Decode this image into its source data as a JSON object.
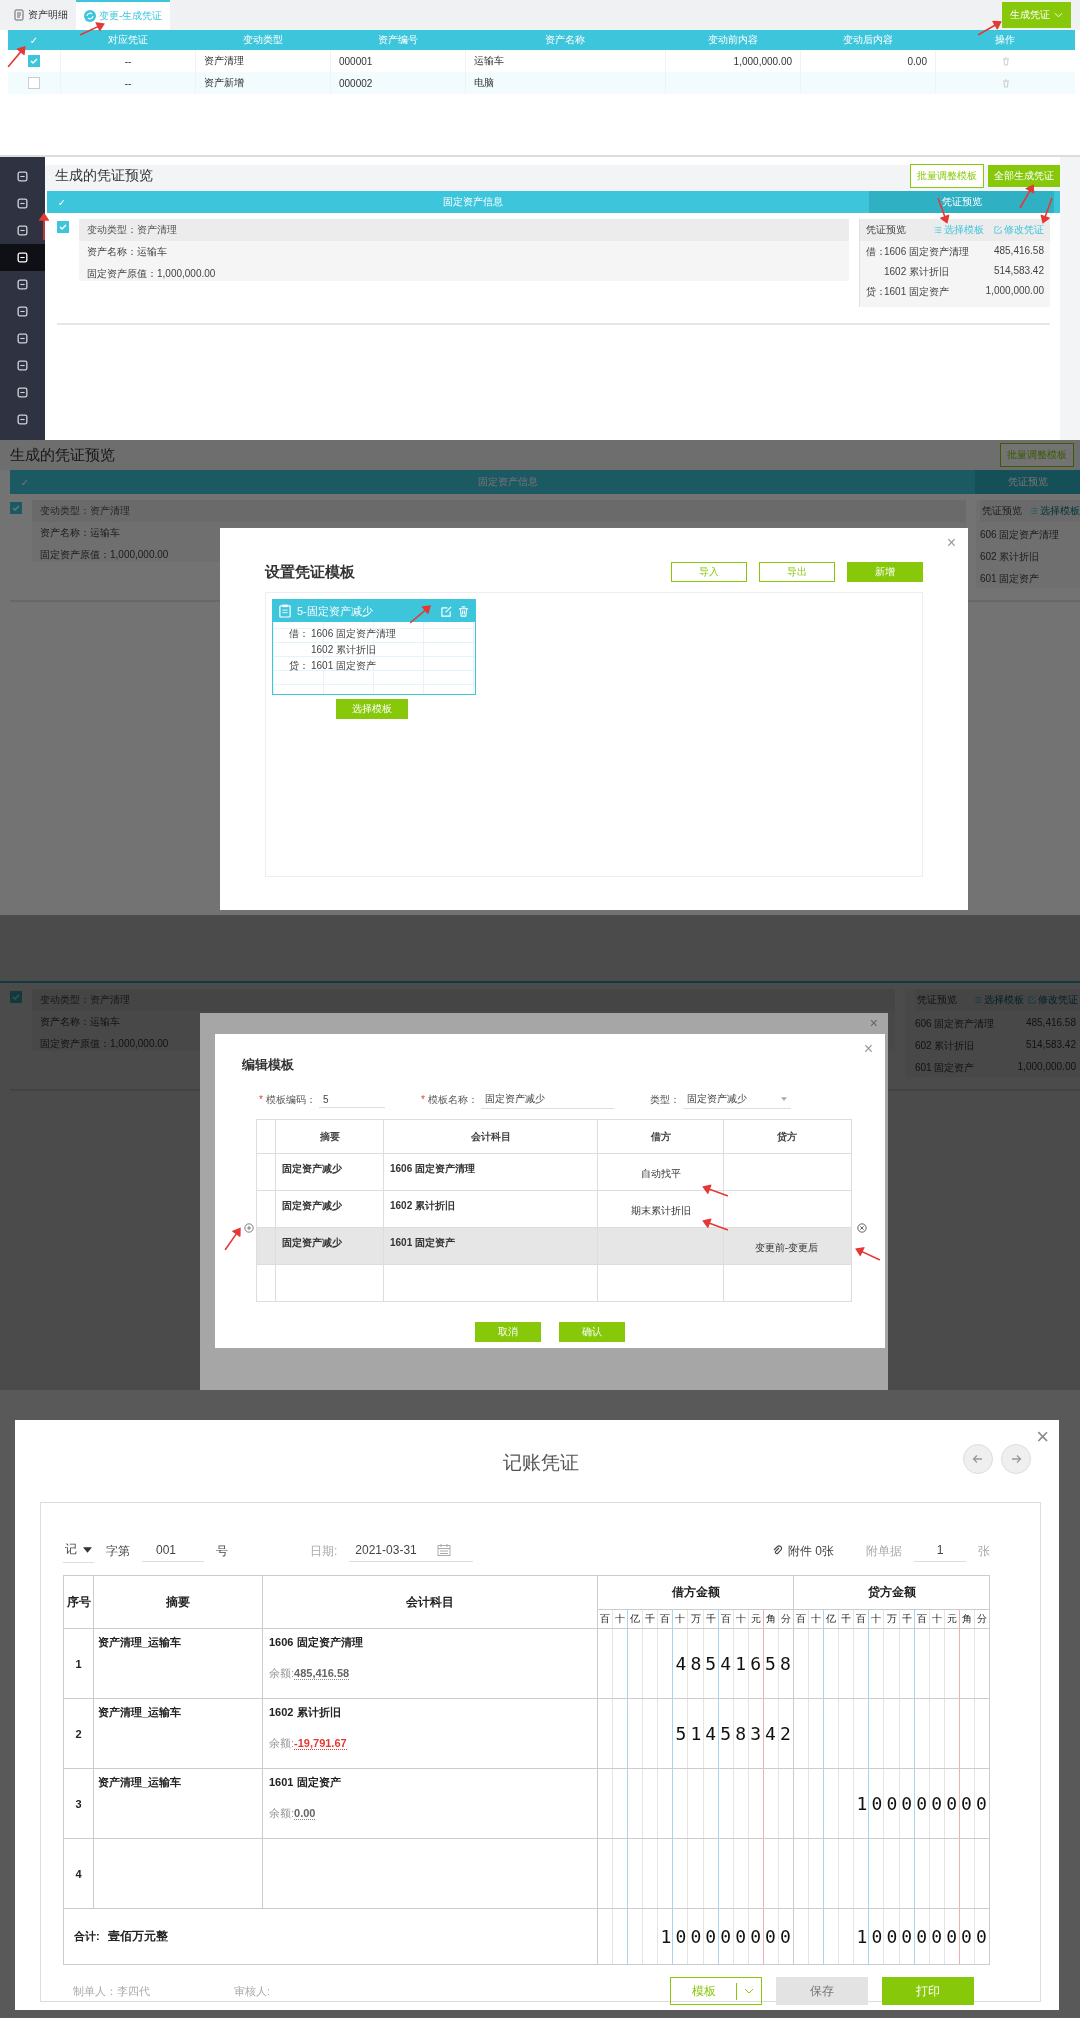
{
  "asset_page": {
    "tabs": [
      {
        "label": "资产明细",
        "selected": false
      },
      {
        "label": "变更-生成凭证",
        "selected": true
      }
    ],
    "generate_button": "生成凭证",
    "columns": [
      "✓",
      "对应凭证",
      "变动类型",
      "资产编号",
      "资产名称",
      "变动前内容",
      "变动后内容",
      "操作"
    ],
    "rows": [
      {
        "checked": true,
        "voucher": "--",
        "type": "资产清理",
        "code": "000001",
        "name": "运输车",
        "before": "1,000,000.00",
        "after": "0.00"
      },
      {
        "checked": false,
        "voucher": "--",
        "type": "资产新增",
        "code": "000002",
        "name": "电脑"
      }
    ]
  },
  "preview_page": {
    "sidebar": [
      {
        "selected": false
      },
      {
        "selected": false
      },
      {
        "selected": false
      },
      {
        "selected": true
      },
      {
        "selected": false
      },
      {
        "selected": false
      },
      {
        "selected": false
      },
      {
        "selected": false
      },
      {
        "selected": false
      },
      {
        "selected": false
      }
    ],
    "title": "生成的凭证预览",
    "buttons": [
      {
        "label": "批量调整模板",
        "kind": "outline"
      },
      {
        "label": "全部生成凭证",
        "kind": "primary"
      }
    ],
    "header": {
      "check": "✓",
      "info": "固定资产信息",
      "preview": "凭证预览"
    },
    "card": {
      "checked": true,
      "type_line": "变动类型：资产清理",
      "lines": [
        "资产名称：运输车",
        "固定资产原值：1,000,000.00"
      ]
    },
    "voucher": {
      "title": "凭证预览",
      "links": [
        {
          "label": "选择模板",
          "kind": "list"
        },
        {
          "label": "修改凭证",
          "kind": "edit"
        }
      ],
      "entries": [
        {
          "side": "借：",
          "account": "1606 固定资产清理",
          "amount": "485,416.58"
        },
        {
          "account": "1602 累计折旧",
          "amount": "514,583.42"
        },
        {
          "side": "贷：",
          "account": "1601 固定资产",
          "amount": "1,000,000.00"
        }
      ]
    }
  },
  "template_dialog": {
    "backdrop": {
      "title": "生成的凭证预览",
      "button": "批量调整模板",
      "header": {
        "check": "✓",
        "info": "固定资产信息",
        "preview": "凭证预览"
      },
      "card": {
        "checked": true,
        "type_line": "变动类型：资产清理",
        "lines": [
          "资产名称：运输车",
          "固定资产原值：1,000,000.00"
        ]
      },
      "voucher": {
        "title": "凭证预览",
        "links": [
          {
            "label": "选择模板",
            "kind": "list"
          }
        ],
        "entries": [
          {
            "account": "606 固定资产清理"
          },
          {
            "account": "602 累计折旧"
          },
          {
            "account": "601 固定资产"
          }
        ]
      }
    },
    "close": "×",
    "title": "设置凭证模板",
    "buttons": [
      {
        "label": "导入",
        "kind": "outline"
      },
      {
        "label": "导出",
        "kind": "outline"
      },
      {
        "label": "新增",
        "kind": "primary"
      }
    ],
    "template": {
      "name": "5-固定资产减少",
      "lines": [
        {
          "side": "借：",
          "account": "1606 固定资产清理"
        },
        {
          "account": "1602 累计折旧"
        },
        {
          "side": "贷：",
          "account": "1601 固定资产"
        }
      ],
      "button": "选择模板"
    }
  },
  "edit_dialog": {
    "backdrop": {
      "card": {
        "checked": true,
        "type_line": "变动类型：资产清理",
        "lines": [
          "资产名称：运输车",
          "固定资产原值：1,000,000.00"
        ]
      },
      "voucher": {
        "title": "凭证预览",
        "links": [
          {
            "label": "选择模板",
            "kind": "list"
          },
          {
            "label": "修改凭证",
            "kind": "edit"
          }
        ],
        "entries": [
          {
            "account": "606 固定资产清理",
            "amount": "485,416.58"
          },
          {
            "account": "602 累计折旧",
            "amount": "514,583.42"
          },
          {
            "account": "601 固定资产",
            "amount": "1,000,000.00"
          }
        ]
      }
    },
    "back_close": "×",
    "close": "×",
    "title": "编辑模板",
    "fields": [
      {
        "mark": "*",
        "label": "模板编码：",
        "value": "5",
        "kind": "text"
      },
      {
        "mark": "*",
        "label": "模板名称：",
        "value": "固定资产减少",
        "kind": "text"
      },
      {
        "label": "类型：",
        "value": "固定资产减少",
        "kind": "select"
      }
    ],
    "columns": [
      "摘要",
      "会计科目",
      "借方",
      "贷方"
    ],
    "rows": [
      {
        "summary": "固定资产减少",
        "account": "1606 固定资产清理",
        "debit": "自动找平",
        "highlighted": false
      },
      {
        "summary": "固定资产减少",
        "account": "1602 累计折旧",
        "debit": "期末累计折旧",
        "highlighted": false
      },
      {
        "summary": "固定资产减少",
        "account": "1601 固定资产",
        "credit": "变更前-变更后",
        "highlighted": true
      },
      {
        "highlighted": false
      }
    ],
    "buttons": [
      {
        "label": "取消"
      },
      {
        "label": "确认"
      }
    ]
  },
  "voucher_dialog": {
    "close": "×",
    "title": "记账凭证",
    "type": "记",
    "word": "字第",
    "number": "001",
    "number_suffix": "号",
    "date_label": "日期:",
    "date": "2021-03-31",
    "attachment": "附件 0张",
    "docs_label": "附单据",
    "docs": "1",
    "docs_unit": "张",
    "columns": {
      "no": "序号",
      "summary": "摘要",
      "account": "会计科目",
      "debit": {
        "label": "借方金额",
        "units": [
          "百",
          "十",
          "亿",
          "千",
          "百",
          "十",
          "万",
          "千",
          "百",
          "十",
          "元",
          "角",
          "分"
        ]
      },
      "credit": {
        "label": "贷方金额",
        "units": [
          "百",
          "十",
          "亿",
          "千",
          "百",
          "十",
          "万",
          "千",
          "百",
          "十",
          "元",
          "角",
          "分"
        ]
      }
    },
    "rows": [
      {
        "no": "1",
        "summary": "资产清理_运输车",
        "account": "1606 固定资产清理",
        "balance_label": "余额:",
        "balance": "485,416.58",
        "negative": false,
        "debit": "48541658"
      },
      {
        "no": "2",
        "summary": "资产清理_运输车",
        "account": "1602 累计折旧",
        "balance_label": "余额:",
        "balance": "-19,791.67",
        "negative": true,
        "debit": "51458342"
      },
      {
        "no": "3",
        "summary": "资产清理_运输车",
        "account": "1601 固定资产",
        "balance_label": "余额:",
        "balance": "0.00",
        "negative": false,
        "credit": "100000000"
      },
      {
        "no": "4"
      }
    ],
    "total": {
      "label": "合计:",
      "words": "壹佰万元整",
      "debit": "100000000",
      "credit": "100000000"
    },
    "maker": "制单人：李四代",
    "reviewer": "审核人:",
    "buttons": [
      {
        "label": "模板",
        "kind": "split"
      },
      {
        "label": "保存",
        "kind": "disabled"
      },
      {
        "label": "打印",
        "kind": "primary"
      }
    ]
  }
}
